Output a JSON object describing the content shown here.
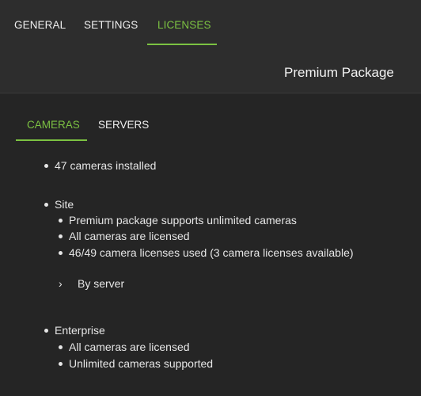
{
  "tabs": [
    {
      "label": "GENERAL"
    },
    {
      "label": "SETTINGS"
    },
    {
      "label": "LICENSES"
    }
  ],
  "header": {
    "package_title": "Premium Package"
  },
  "subtabs": [
    {
      "label": "CAMERAS"
    },
    {
      "label": "SERVERS"
    }
  ],
  "cameras": {
    "installed": "47 cameras installed",
    "site": {
      "title": "Site",
      "items": [
        "Premium package supports unlimited cameras",
        "All cameras are licensed",
        "46/49 camera licenses used (3 camera licenses available)"
      ],
      "by_server": "By server"
    },
    "enterprise": {
      "title": "Enterprise",
      "items": [
        "All cameras are licensed",
        "Unlimited cameras supported"
      ]
    }
  },
  "icons": {
    "expand": "chevron-right-icon"
  },
  "colors": {
    "accent": "#7cc242",
    "background": "#252525",
    "header": "#2d2d2d"
  }
}
